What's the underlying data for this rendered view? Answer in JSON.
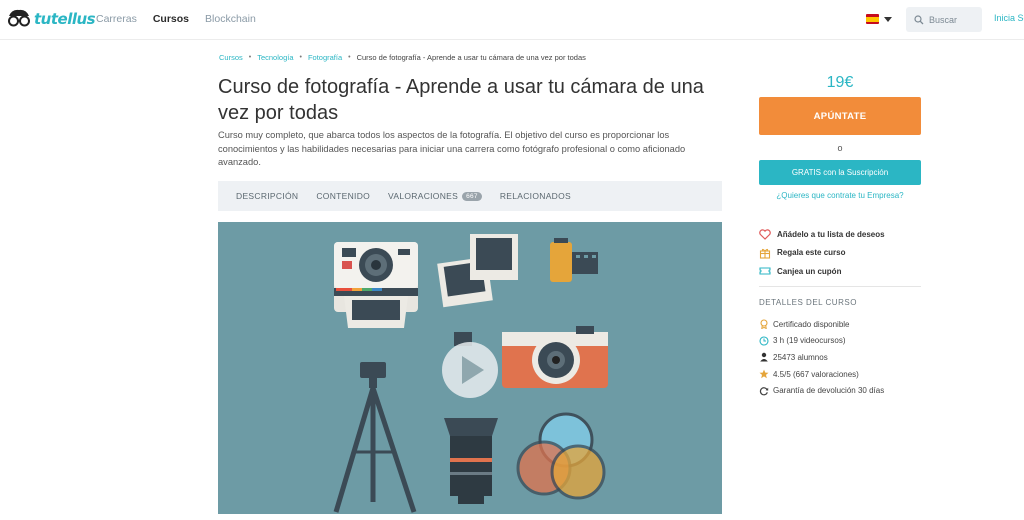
{
  "header": {
    "logo_text": "tutellus",
    "nav": [
      {
        "label": "Carreras",
        "active": false
      },
      {
        "label": "Cursos",
        "active": true
      },
      {
        "label": "Blockchain",
        "active": false
      }
    ],
    "search_placeholder": "Buscar",
    "login_label": "Inicia Ses"
  },
  "breadcrumb": {
    "items": [
      "Cursos",
      "Tecnología",
      "Fotografía"
    ],
    "current": "Curso de fotografía - Aprende a usar tu cámara de una vez por todas"
  },
  "course": {
    "title": "Curso de fotografía - Aprende a usar tu cámara de una vez por todas",
    "description": "Curso muy completo, que abarca todos los aspectos de la fotografía. El objetivo del curso es proporcionar los conocimientos y las habilidades necesarias para iniciar una carrera como fotógrafo profesional o como aficionado avanzado."
  },
  "tabs": [
    {
      "label": "DESCRIPCIÓN"
    },
    {
      "label": "CONTENIDO"
    },
    {
      "label": "VALORACIONES",
      "badge": "667"
    },
    {
      "label": "RELACIONADOS"
    }
  ],
  "sidebar": {
    "price": "19€",
    "enroll_label": "APÚNTATE",
    "or_label": "o",
    "subscription_label": "GRATIS con la Suscripción",
    "company_prefix": "¿Quieres que contrate tu ",
    "company_link": "Empresa?",
    "actions": [
      {
        "label": "Añádelo a tu lista de deseos",
        "icon": "heart-icon"
      },
      {
        "label": "Regala este curso",
        "icon": "gift-icon"
      },
      {
        "label": "Canjea un cupón",
        "icon": "coupon-icon"
      }
    ],
    "details_title": "DETALLES DEL CURSO",
    "details": [
      {
        "label": "Certificado disponible",
        "icon": "certificate-icon"
      },
      {
        "label": "3 h (19 videocursos)",
        "icon": "clock-icon"
      },
      {
        "label": "25473 alumnos",
        "icon": "user-icon"
      },
      {
        "label": "4.5/5 (667 valoraciones)",
        "icon": "star-icon"
      },
      {
        "label": "Garantía de devolución 30 días",
        "icon": "refresh-icon"
      }
    ]
  },
  "colors": {
    "accent": "#2bb6c4",
    "orange": "#f28c3a",
    "hero_bg": "#6d9ba5"
  }
}
